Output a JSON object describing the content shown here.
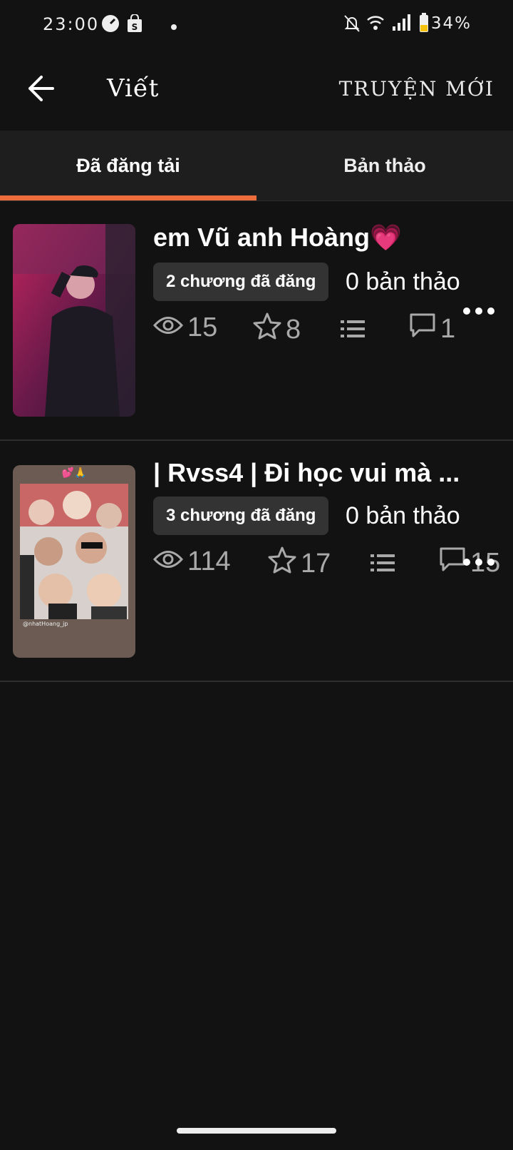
{
  "status_bar": {
    "time": "23:00",
    "battery": "34%",
    "icons": [
      "speedometer-icon",
      "shop-bag-icon",
      "dot-icon",
      "mute-bell-icon",
      "wifi-icon",
      "signal-icon",
      "battery-icon"
    ]
  },
  "app_bar": {
    "title": "Viết",
    "new_story_label": "TRUYỆN MỚI"
  },
  "tabs": [
    {
      "label": "Đã đăng tải",
      "active": true
    },
    {
      "label": "Bản thảo",
      "active": false
    }
  ],
  "stories": [
    {
      "title": "em Vũ anh Hoàng💗",
      "published_parts": "2 chương đã đăng",
      "drafts": "0 bản thảo",
      "reads": "15",
      "votes": "8",
      "comments": "1"
    },
    {
      "title": "| Rvss4 | Đi học vui mà ...",
      "published_parts": "3 chương đã đăng",
      "drafts": "0 bản thảo",
      "reads": "114",
      "votes": "17",
      "comments": "15",
      "cover_emoji": "💕🙏",
      "cover_caption": "@nhatHoang_jp"
    }
  ],
  "colors": {
    "background": "#121212",
    "accent": "#ee6d3d",
    "tab_bar": "#1e1e1e",
    "stat_gray": "#a9a9a9"
  }
}
